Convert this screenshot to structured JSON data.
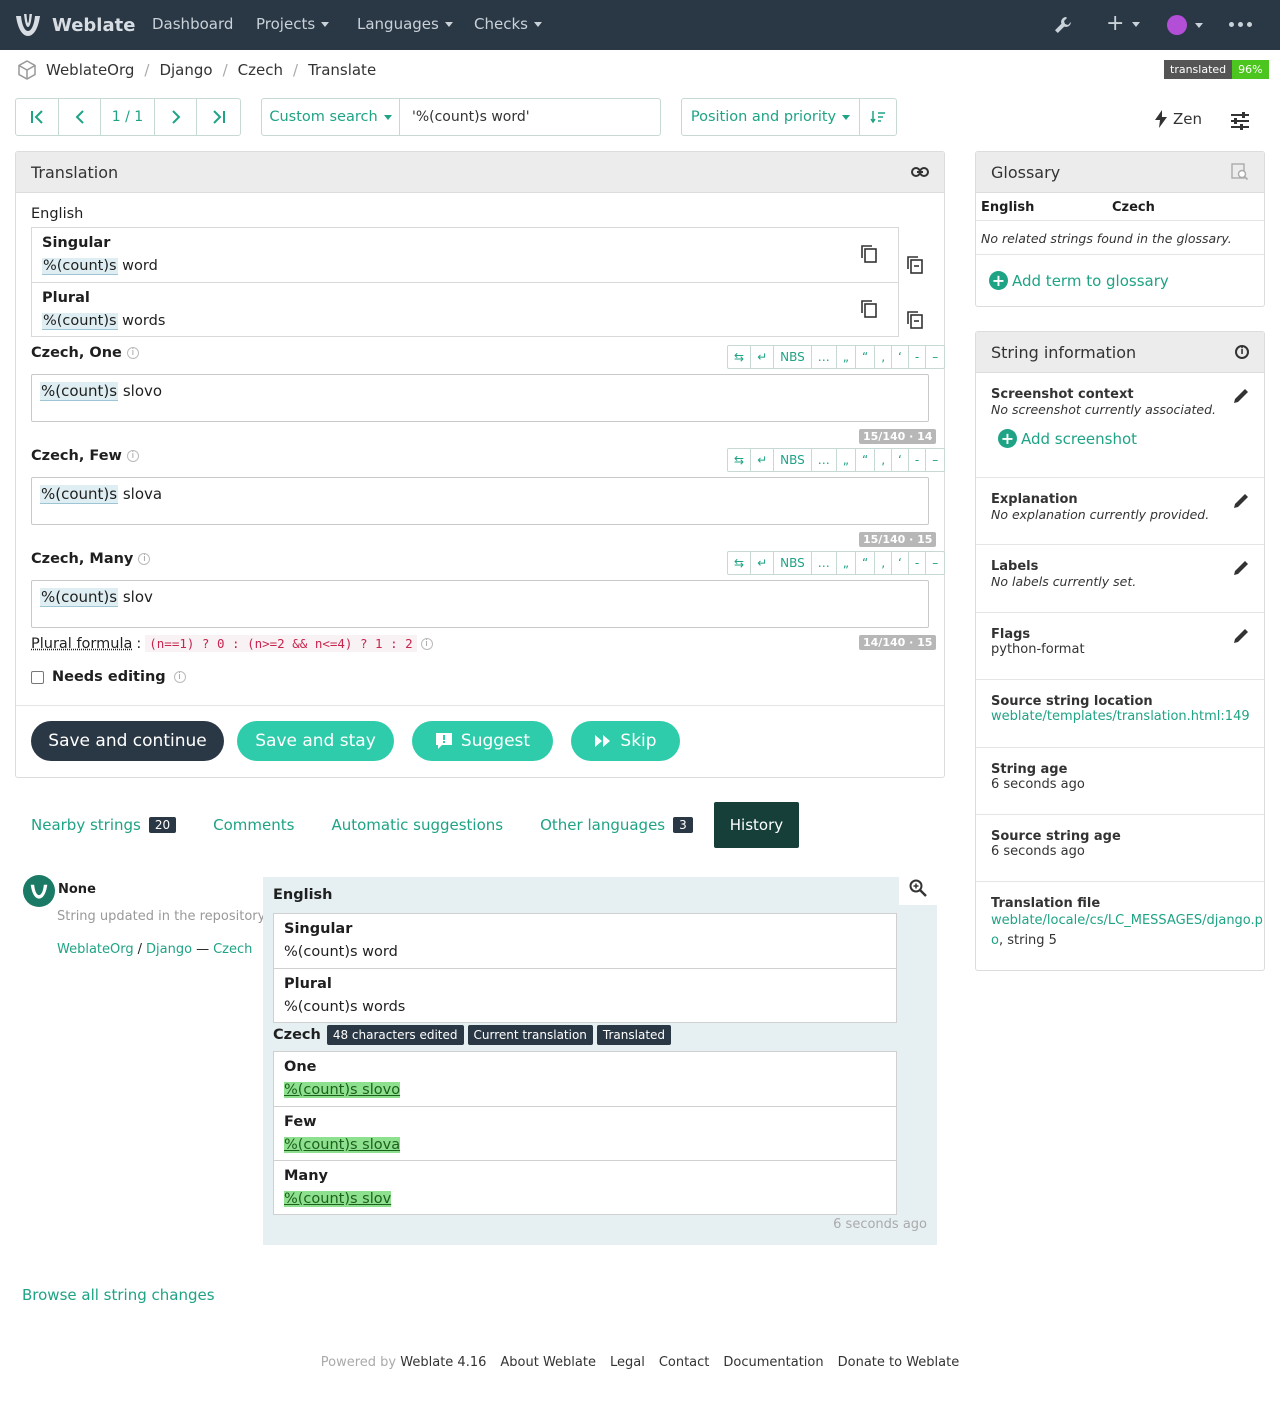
{
  "nav": {
    "brand": "Weblate",
    "items": [
      "Dashboard",
      "Projects",
      "Languages",
      "Checks"
    ]
  },
  "breadcrumb": [
    "WeblateOrg",
    "Django",
    "Czech",
    "Translate"
  ],
  "status_badge": {
    "label": "translated",
    "value": "96%"
  },
  "pager": {
    "position": "1 / 1"
  },
  "search": {
    "mode": "Custom search",
    "query": "'%(count)s word'"
  },
  "sort": {
    "label": "Position and priority"
  },
  "zen_label": "Zen",
  "translation": {
    "title": "Translation",
    "source_language": "English",
    "source": [
      {
        "label": "Singular",
        "placeholder": "%(count)s",
        "rest": " word"
      },
      {
        "label": "Plural",
        "placeholder": "%(count)s",
        "rest": " words"
      }
    ],
    "forms": [
      {
        "label": "Czech, One",
        "placeholder": "%(count)s",
        "rest": " slovo",
        "counter": "15/140 · 14"
      },
      {
        "label": "Czech, Few",
        "placeholder": "%(count)s",
        "rest": " slova",
        "counter": "15/140 · 15"
      },
      {
        "label": "Czech, Many",
        "placeholder": "%(count)s",
        "rest": " slov",
        "counter": "14/140 · 15"
      }
    ],
    "tools": [
      "⇆",
      "↵",
      "NBS",
      "…",
      "„",
      "“",
      "‚",
      "‘",
      "-",
      "–"
    ],
    "plural_formula_label": "Plural formula",
    "plural_formula": "(n==1) ? 0 : (n>=2 && n<=4) ? 1 : 2",
    "needs_editing": "Needs editing",
    "buttons": {
      "save_continue": "Save and continue",
      "save_stay": "Save and stay",
      "suggest": "Suggest",
      "skip": "Skip"
    }
  },
  "tabs": [
    {
      "label": "Nearby strings",
      "count": "20"
    },
    {
      "label": "Comments",
      "count": ""
    },
    {
      "label": "Automatic suggestions",
      "count": ""
    },
    {
      "label": "Other languages",
      "count": "3"
    },
    {
      "label": "History",
      "count": ""
    }
  ],
  "history": {
    "user": "None",
    "action": "String updated in the repository",
    "link_project": "WeblateOrg",
    "link_component": "Django",
    "link_sep": "/",
    "link_dash": "—",
    "link_language": "Czech",
    "source_language": "English",
    "source": [
      {
        "label": "Singular",
        "text": "%(count)s word"
      },
      {
        "label": "Plural",
        "text": "%(count)s words"
      }
    ],
    "target_language": "Czech",
    "badges": [
      "48 characters edited",
      "Current translation",
      "Translated"
    ],
    "target": [
      {
        "label": "One",
        "text": "%(count)s slovo"
      },
      {
        "label": "Few",
        "text": "%(count)s slova"
      },
      {
        "label": "Many",
        "text": "%(count)s slov"
      }
    ],
    "age": "6 seconds ago",
    "browse_all": "Browse all string changes"
  },
  "glossary": {
    "title": "Glossary",
    "col_source": "English",
    "col_target": "Czech",
    "empty": "No related strings found in the glossary.",
    "add": "Add term to glossary"
  },
  "string_info": {
    "title": "String information",
    "screenshot_title": "Screenshot context",
    "screenshot_value": "No screenshot currently associated.",
    "add_screenshot": "Add screenshot",
    "explanation_title": "Explanation",
    "explanation_value": "No explanation currently provided.",
    "labels_title": "Labels",
    "labels_value": "No labels currently set.",
    "flags_title": "Flags",
    "flags_value": "python-format",
    "location_title": "Source string location",
    "location_value": "weblate/templates/translation.html:149",
    "age_title": "String age",
    "age_value": "6 seconds ago",
    "source_age_title": "Source string age",
    "source_age_value": "6 seconds ago",
    "file_title": "Translation file",
    "file_link_1": "weblate/locale/cs/LC_MESSAGES/django.p",
    "file_link_2": "o",
    "file_suffix": ", string 5"
  },
  "footer": {
    "powered_by": "Powered by",
    "version": "Weblate 4.16",
    "links": [
      "About Weblate",
      "Legal",
      "Contact",
      "Documentation",
      "Donate to Weblate"
    ]
  },
  "colors": {
    "accent": "#1fa385",
    "nav": "#2a3744",
    "primary_button": "#2a3744",
    "secondary_button": "#2eccaa",
    "inserted": "#8de08d"
  }
}
